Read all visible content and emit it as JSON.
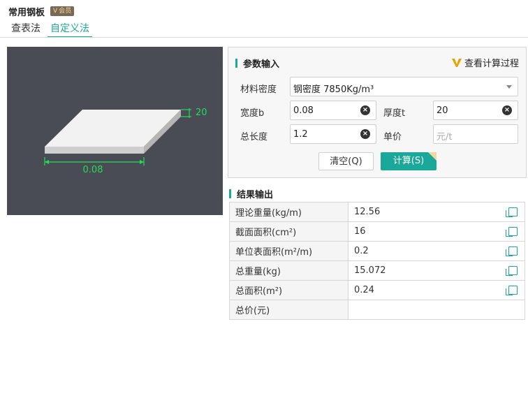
{
  "header": {
    "title": "常用钢板",
    "vip_badge": "会员"
  },
  "tabs": [
    {
      "label": "查表法",
      "active": false
    },
    {
      "label": "自定义法",
      "active": true
    }
  ],
  "preview": {
    "width_label": "0.08",
    "thickness_label": "20"
  },
  "params": {
    "section_title": "参数输入",
    "view_process_label": "查看计算过程",
    "density_label": "材料密度",
    "density_value": "钢密度 7850Kg/m³",
    "width_label": "宽度b",
    "width_value": "0.08",
    "thickness_label": "厚度t",
    "thickness_value": "20",
    "length_label": "总长度",
    "length_value": "1.2",
    "unit_price_label": "单价",
    "unit_price_placeholder": "元/t",
    "clear_button": "清空(Q)",
    "calc_button": "计算(S)"
  },
  "results": {
    "section_title": "结果输出",
    "rows": [
      {
        "key": "理论重量(kg/m)",
        "value": "12.56"
      },
      {
        "key": "截面面积(cm²)",
        "value": "16"
      },
      {
        "key": "单位表面积(m²/m)",
        "value": "0.2"
      },
      {
        "key": "总重量(kg)",
        "value": "15.072"
      },
      {
        "key": "总面积(m²)",
        "value": "0.24"
      },
      {
        "key": "总价(元)",
        "value": ""
      }
    ]
  },
  "colors": {
    "accent": "#1aa89a",
    "preview_bg": "#4a4c55",
    "dimension_green": "#22dd55"
  }
}
